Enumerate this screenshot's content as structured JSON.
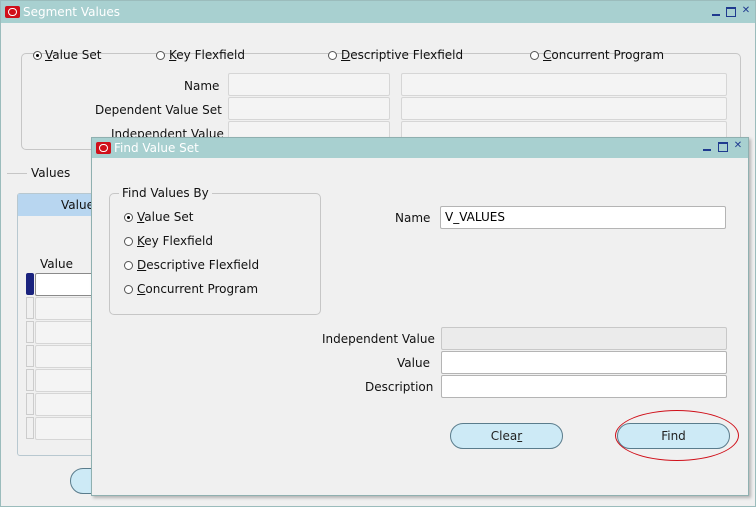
{
  "back_window": {
    "title": "Segment Values",
    "radios": [
      {
        "pre": "",
        "ul": "V",
        "post": "alue Set",
        "selected": true
      },
      {
        "pre": "",
        "ul": "K",
        "post": "ey Flexfield",
        "selected": false
      },
      {
        "pre": "",
        "ul": "D",
        "post": "escriptive Flexfield",
        "selected": false
      },
      {
        "pre": "",
        "ul": "C",
        "post": "oncurrent Program",
        "selected": false
      }
    ],
    "name_label": "Name",
    "dependent_label": "Dependent Value Set",
    "independent_label": "Independent Value",
    "values_section": "Values",
    "values_tab": "Value",
    "value_col": "Value"
  },
  "dialog": {
    "title": "Find Value Set",
    "group_title": "Find Values By",
    "options": [
      {
        "ul": "V",
        "post": "alue Set",
        "selected": true
      },
      {
        "ul": "K",
        "post": "ey Flexfield",
        "selected": false
      },
      {
        "ul": "D",
        "post": "escriptive Flexfield",
        "selected": false
      },
      {
        "ul": "C",
        "post": "oncurrent Program",
        "selected": false
      }
    ],
    "name_label": "Name",
    "name_value": "V_VALUES",
    "independent_label": "Independent Value",
    "value_label": "Value",
    "description_label": "Description",
    "clear_pre": "Clea",
    "clear_ul": "r",
    "find_label": "Find"
  },
  "colors": {
    "titlebar": "#a8d0d0",
    "highlight_oval": "#d0101a",
    "button": "#cdeaf6"
  }
}
